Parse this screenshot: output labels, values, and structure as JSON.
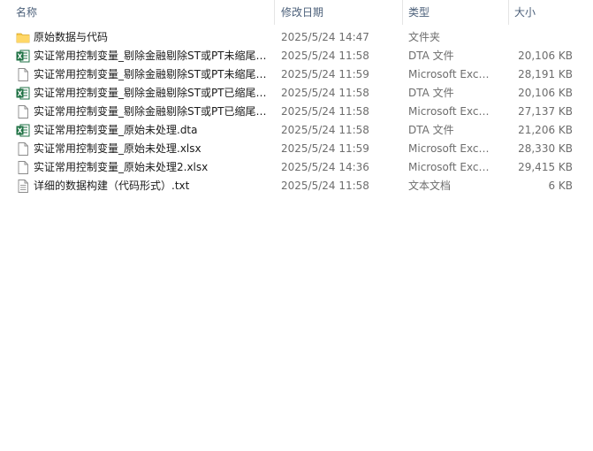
{
  "columns": {
    "name": "名称",
    "date": "修改日期",
    "type": "类型",
    "size": "大小"
  },
  "sort_indicator": "^",
  "colors": {
    "header_text": "#4c607a",
    "folder": "#f7c948",
    "excel_green": "#1f7244"
  },
  "files": [
    {
      "icon": "folder-icon",
      "name": "原始数据与代码",
      "date": "2025/5/24 14:47",
      "type": "文件夹",
      "size": ""
    },
    {
      "icon": "excel-dta-icon",
      "name": "实证常用控制变量_剔除金融剔除ST或PT未缩尾.dta",
      "date": "2025/5/24 11:58",
      "type": "DTA 文件",
      "size": "20,106 KB"
    },
    {
      "icon": "blank-file-icon",
      "name": "实证常用控制变量_剔除金融剔除ST或PT未缩尾.xlsx",
      "date": "2025/5/24 11:59",
      "type": "Microsoft Excel ...",
      "size": "28,191 KB"
    },
    {
      "icon": "excel-dta-icon",
      "name": "实证常用控制变量_剔除金融剔除ST或PT已缩尾.dta",
      "date": "2025/5/24 11:58",
      "type": "DTA 文件",
      "size": "20,106 KB"
    },
    {
      "icon": "blank-file-icon",
      "name": "实证常用控制变量_剔除金融剔除ST或PT已缩尾.xlsx",
      "date": "2025/5/24 11:58",
      "type": "Microsoft Excel ...",
      "size": "27,137 KB"
    },
    {
      "icon": "excel-dta-icon",
      "name": "实证常用控制变量_原始未处理.dta",
      "date": "2025/5/24 11:58",
      "type": "DTA 文件",
      "size": "21,206 KB"
    },
    {
      "icon": "blank-file-icon",
      "name": "实证常用控制变量_原始未处理.xlsx",
      "date": "2025/5/24 11:59",
      "type": "Microsoft Excel ...",
      "size": "28,330 KB"
    },
    {
      "icon": "blank-file-icon",
      "name": "实证常用控制变量_原始未处理2.xlsx",
      "date": "2025/5/24 14:36",
      "type": "Microsoft Excel ...",
      "size": "29,415 KB"
    },
    {
      "icon": "text-file-icon",
      "name": "详细的数据构建（代码形式）.txt",
      "date": "2025/5/24 11:58",
      "type": "文本文档",
      "size": "6 KB"
    }
  ]
}
